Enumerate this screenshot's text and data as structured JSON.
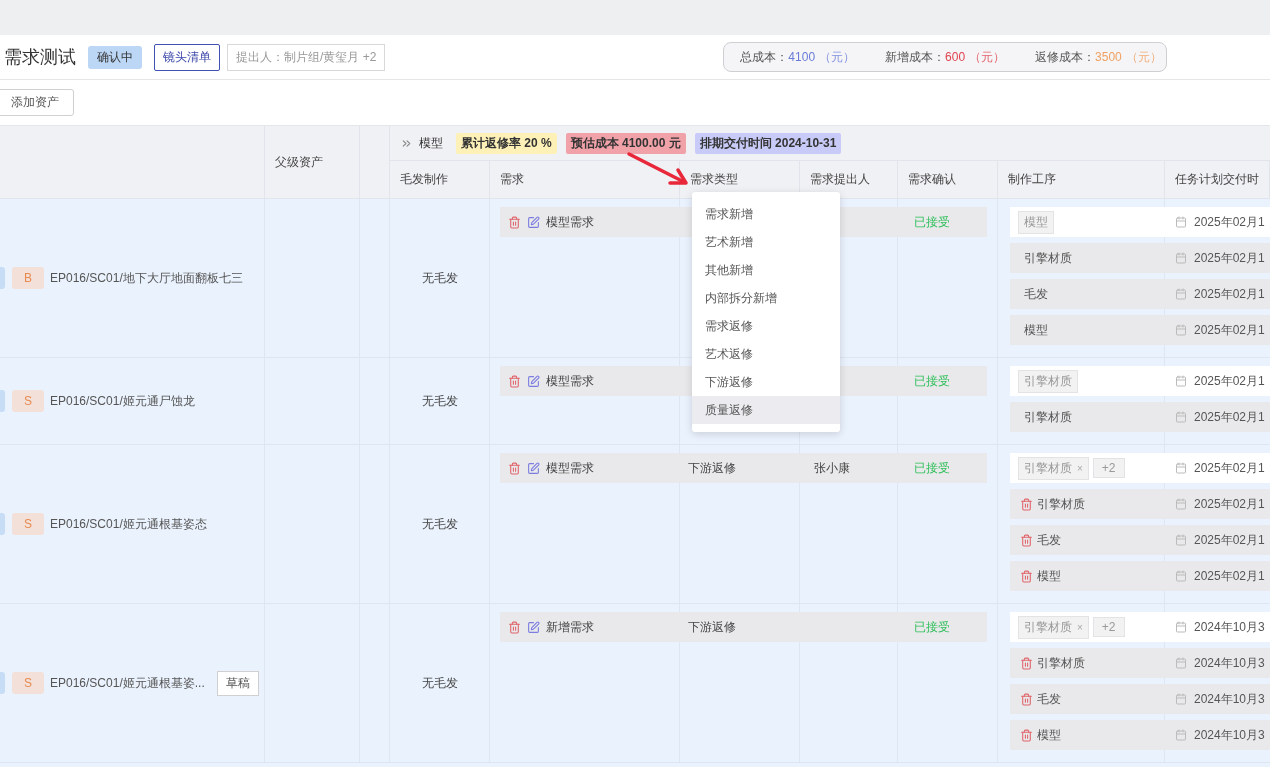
{
  "header": {
    "title": "需求测试",
    "status": "确认中",
    "shot_list_button": "镜头清单",
    "proposer": "提出人：制片组/黄玺月 +2",
    "costs": [
      {
        "label": "总成本：",
        "value": "4100",
        "unit": "（元）",
        "color": "#6a7bd8"
      },
      {
        "label": "新增成本：",
        "value": "600",
        "unit": "（元）",
        "color": "#e0434e"
      },
      {
        "label": "返修成本：",
        "value": "3500",
        "unit": "（元）",
        "color": "#f0a060"
      }
    ]
  },
  "toolbar": {
    "add_button": "添加资产"
  },
  "group_header": {
    "name": "模型",
    "tags": [
      {
        "text": "累计返修率 20 %",
        "color": "#fdf1b8"
      },
      {
        "text": "预估成本 4100.00 元",
        "color": "#f0a2a8"
      },
      {
        "text": "排期交付时间 2024-10-31",
        "color": "#c8cbf7"
      }
    ]
  },
  "columns": [
    "父级资产",
    "毛发制作",
    "需求",
    "需求类型",
    "需求提出人",
    "需求确认",
    "制作工序",
    "任务计划交付时"
  ],
  "rows": [
    {
      "grade": "B",
      "asset": "EP016/SC01/地下大厅地面翻板七三",
      "hair": "无毛发",
      "demand": "模型需求",
      "confirm": "已接受",
      "selection": {
        "tags": [
          {
            "text": "模型"
          }
        ],
        "date": "2025年02月1"
      },
      "steps": [
        {
          "name": "引擎材质",
          "date": "2025年02月1",
          "deletable": false
        },
        {
          "name": "毛发",
          "date": "2025年02月1",
          "deletable": false
        },
        {
          "name": "模型",
          "date": "2025年02月1",
          "deletable": false
        }
      ]
    },
    {
      "grade": "S",
      "asset": "EP016/SC01/姬元通尸蚀龙",
      "hair": "无毛发",
      "demand": "模型需求",
      "confirm": "已接受",
      "selection": {
        "tags": [
          {
            "text": "引擎材质"
          }
        ],
        "date": "2025年02月1"
      },
      "steps": [
        {
          "name": "引擎材质",
          "date": "2025年02月1",
          "deletable": false
        }
      ]
    },
    {
      "grade": "S",
      "asset": "EP016/SC01/姬元通根基姿态",
      "hair": "无毛发",
      "demand": "模型需求",
      "type": "下游返修",
      "proposer": "张小康",
      "confirm": "已接受",
      "selection": {
        "tags": [
          {
            "text": "引擎材质",
            "remove": "×"
          }
        ],
        "more": "+2",
        "date": "2025年02月1"
      },
      "steps": [
        {
          "name": "引擎材质",
          "date": "2025年02月1",
          "deletable": true
        },
        {
          "name": "毛发",
          "date": "2025年02月1",
          "deletable": true
        },
        {
          "name": "模型",
          "date": "2025年02月1",
          "deletable": true
        }
      ]
    },
    {
      "grade": "S",
      "asset": "EP016/SC01/姬元通根基姿...",
      "draft": "草稿",
      "hair": "无毛发",
      "demand": "新增需求",
      "type": "下游返修",
      "confirm": "已接受",
      "selection": {
        "tags": [
          {
            "text": "引擎材质",
            "remove": "×"
          }
        ],
        "more": "+2",
        "date": "2024年10月3"
      },
      "steps": [
        {
          "name": "引擎材质",
          "date": "2024年10月3",
          "deletable": true
        },
        {
          "name": "毛发",
          "date": "2024年10月3",
          "deletable": true
        },
        {
          "name": "模型",
          "date": "2024年10月3",
          "deletable": true
        }
      ]
    }
  ],
  "dropdown": {
    "options": [
      {
        "label": "需求新增",
        "highlighted": false
      },
      {
        "label": "艺术新增",
        "highlighted": false
      },
      {
        "label": "其他新增",
        "highlighted": false
      },
      {
        "label": "内部拆分新增",
        "highlighted": false
      },
      {
        "label": "需求返修",
        "highlighted": false
      },
      {
        "label": "艺术返修",
        "highlighted": false
      },
      {
        "label": "下游返修",
        "highlighted": false
      },
      {
        "label": "质量返修",
        "highlighted": true
      }
    ]
  }
}
